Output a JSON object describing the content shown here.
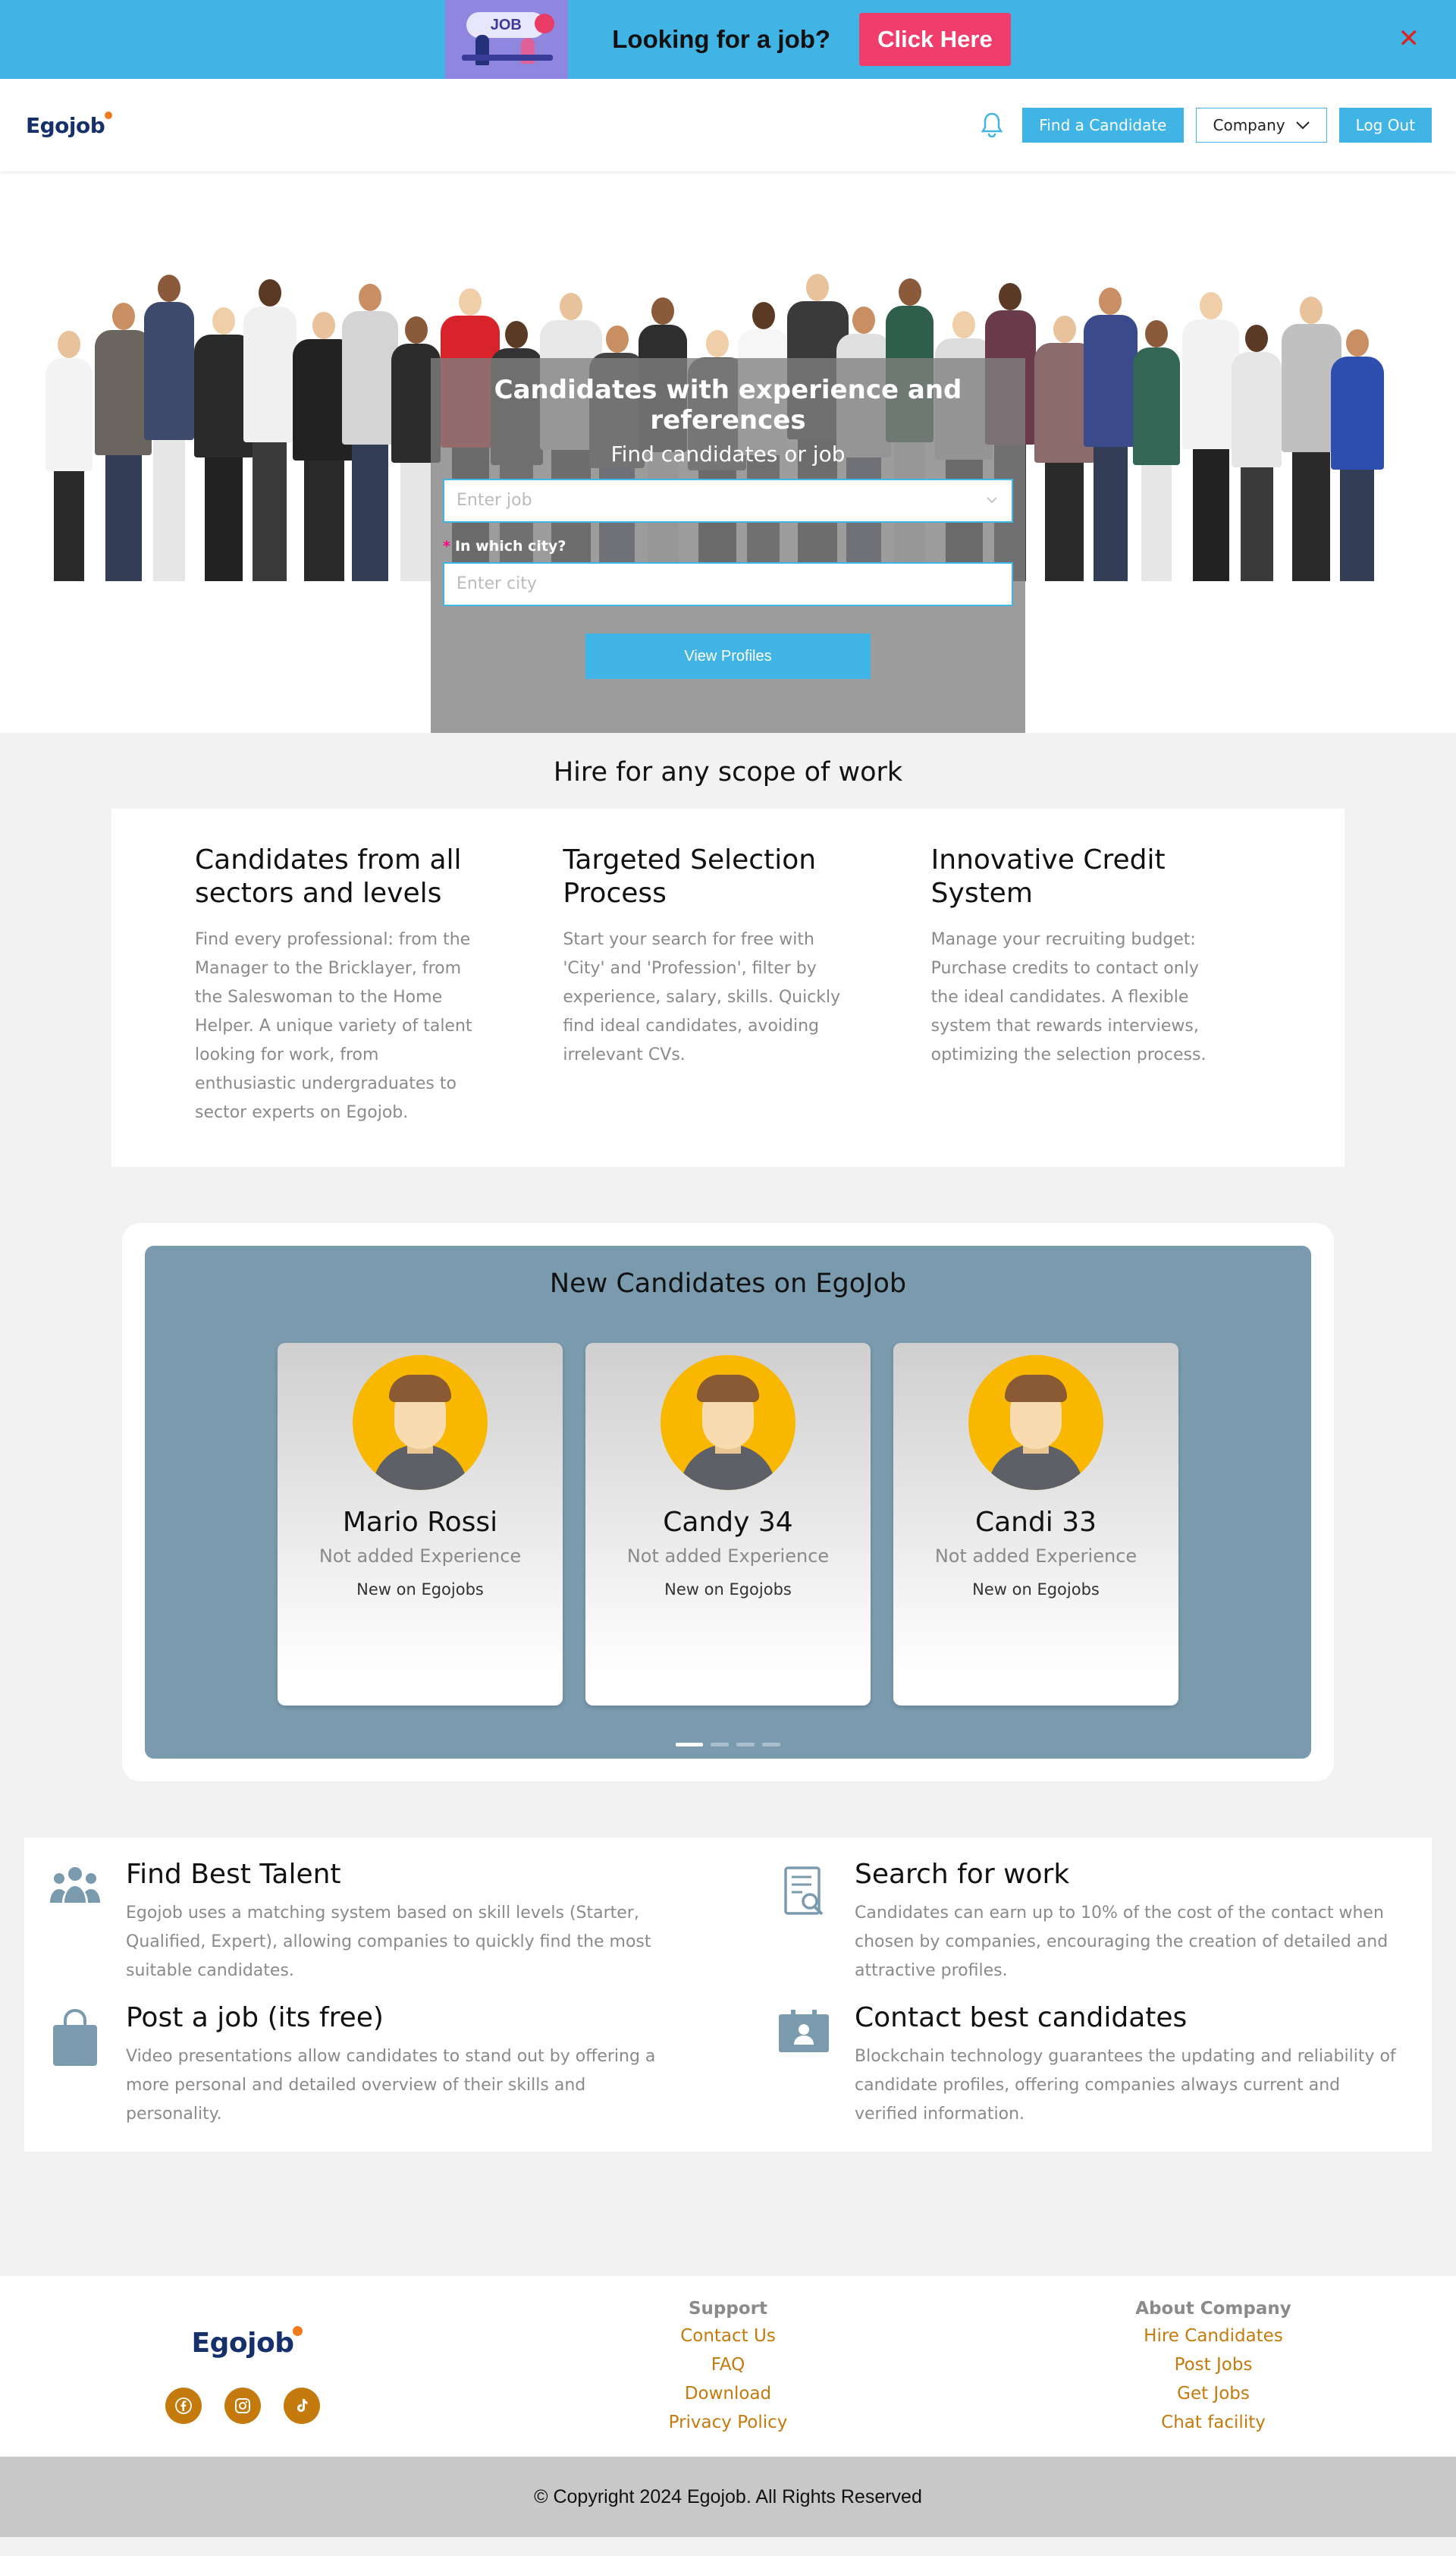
{
  "promo": {
    "image_text": "JOB",
    "text": "Looking for a job?",
    "button": "Click Here",
    "close": "✕"
  },
  "header": {
    "logo": "Egojob",
    "find_candidate": "Find a Candidate",
    "company": "Company",
    "logout": "Log Out"
  },
  "hero": {
    "title": "Candidates with experience and references",
    "subtitle": "Find candidates or job",
    "job_placeholder": "Enter job",
    "city_label": "In which city?",
    "city_placeholder": "Enter city",
    "button": "View Profiles"
  },
  "hire": {
    "title": "Hire for any scope of work",
    "columns": [
      {
        "title": "Candidates from all sectors and levels",
        "text": "Find every professional: from the Manager to the Bricklayer, from the Saleswoman to the Home Helper. A unique variety of talent looking for work, from enthusiastic undergraduates to sector experts on Egojob."
      },
      {
        "title": "Targeted Selection Process",
        "text": "Start your search for free with 'City' and 'Profession', filter by experience, salary, skills. Quickly find ideal candidates, avoiding irrelevant CVs."
      },
      {
        "title": "Innovative Credit System",
        "text": "Manage your recruiting budget: Purchase credits to contact only the ideal candidates. A flexible system that rewards interviews, optimizing the selection process."
      }
    ]
  },
  "candidates": {
    "title": "New Candidates on EgoJob",
    "cards": [
      {
        "name": "Mario Rossi",
        "experience": "Not added Experience",
        "status": "New on Egojobs"
      },
      {
        "name": "Candy 34",
        "experience": "Not added Experience",
        "status": "New on Egojobs"
      },
      {
        "name": "Candi 33",
        "experience": "Not added Experience",
        "status": "New on Egojobs"
      }
    ]
  },
  "features": [
    {
      "icon": "people-icon",
      "title": "Find Best Talent",
      "text": "Egojob uses a matching system based on skill levels (Starter, Qualified, Expert), allowing companies to quickly find the most suitable candidates."
    },
    {
      "icon": "document-search-icon",
      "title": "Search for work",
      "text": "Candidates can earn up to 10% of the cost of the contact when chosen by companies, encouraging the creation of detailed and attractive profiles."
    },
    {
      "icon": "shopping-bag-icon",
      "title": "Post a job (its free)",
      "text": "Video presentations allow candidates to stand out by offering a more personal and detailed overview of their skills and personality."
    },
    {
      "icon": "contact-card-icon",
      "title": "Contact best candidates",
      "text": "Blockchain technology guarantees the updating and reliability of candidate profiles, offering companies always current and verified information."
    }
  ],
  "footer": {
    "logo": "Egojob",
    "support": {
      "title": "Support",
      "links": [
        "Contact Us",
        "FAQ",
        "Download",
        "Privacy Policy"
      ]
    },
    "about": {
      "title": "About Company",
      "links": [
        "Hire Candidates",
        "Post Jobs",
        "Get Jobs",
        "Chat facility"
      ]
    },
    "copyright": "© Copyright 2024 Egojob. All Rights Reserved"
  },
  "colors": {
    "accent": "#41b4e6",
    "promo_button": "#f03e6c",
    "footer_link": "#c47a0d",
    "brand": "#16306b"
  }
}
